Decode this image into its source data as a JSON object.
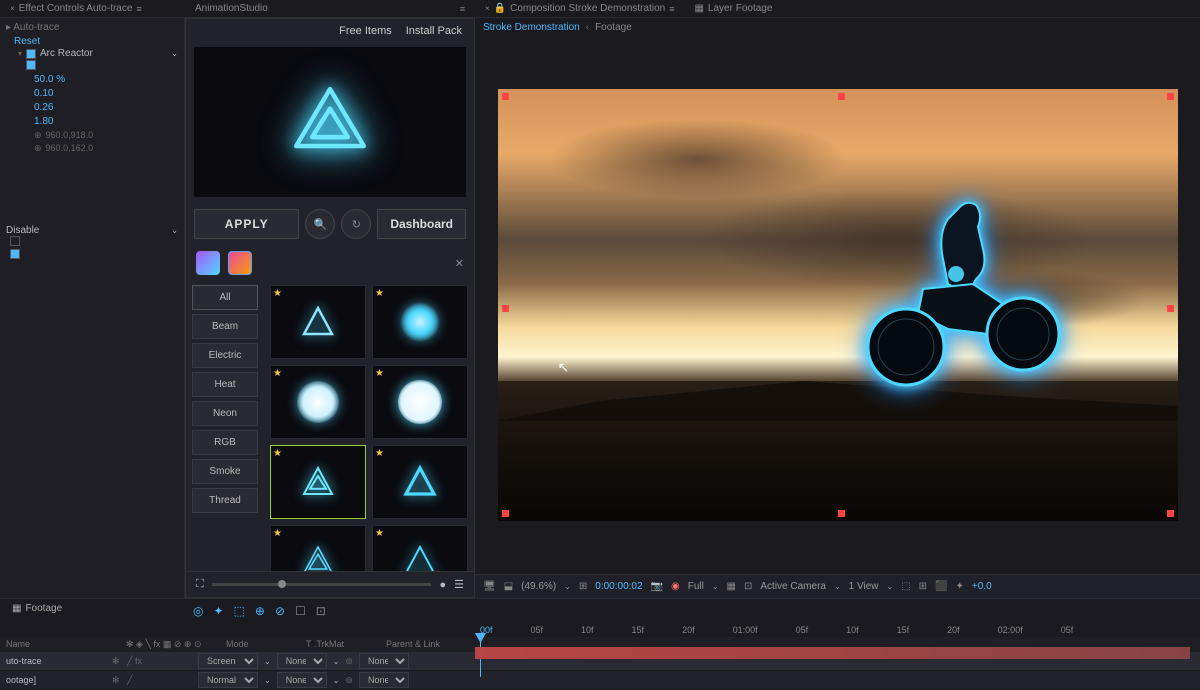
{
  "topTabs": {
    "effectControls": "Effect Controls Auto-trace",
    "animStudio": "AnimationStudio",
    "composition": "Composition Stroke Demonstration",
    "layerFootage": "Layer Footage"
  },
  "effectPanel": {
    "autoTrace": "Auto-trace",
    "reset": "Reset",
    "effectName": "Arc Reactor",
    "values": {
      "v1": "50.0 %",
      "v2": "0.10",
      "v3": "0.26",
      "v4": "1.80"
    },
    "anchors": {
      "a1": "960.0,918.0",
      "a2": "960.0,162.0"
    },
    "disable": "Disable"
  },
  "animPanel": {
    "title": "AnimationStudio",
    "freeItems": "Free Items",
    "installPack": "Install Pack",
    "apply": "APPLY",
    "dashboard": "Dashboard",
    "categories": [
      "All",
      "Beam",
      "Electric",
      "Heat",
      "Neon",
      "RGB",
      "Smoke",
      "Thread"
    ]
  },
  "breadcrumb": {
    "item1": "Stroke Demonstration",
    "item2": "Footage"
  },
  "viewerControls": {
    "zoom": "(49.6%)",
    "timecode": "0:00:00:02",
    "quality": "Full",
    "camera": "Active Camera",
    "views": "1 View",
    "exposure": "+0.0"
  },
  "footageTab": "Footage",
  "timeRuler": [
    "00f",
    "05f",
    "10f",
    "15f",
    "20f",
    "01:00f",
    "05f",
    "10f",
    "15f",
    "20f",
    "02:00f",
    "05f"
  ],
  "layerHeader": {
    "name": "Name",
    "mode": "Mode",
    "trkMat": "T .TrkMat",
    "parent": "Parent & Link"
  },
  "layers": [
    {
      "name": "uto-trace",
      "mode": "Screen",
      "trkmat": "None"
    },
    {
      "name": "ootage]",
      "mode": "Normal",
      "trkmat": "None"
    }
  ]
}
